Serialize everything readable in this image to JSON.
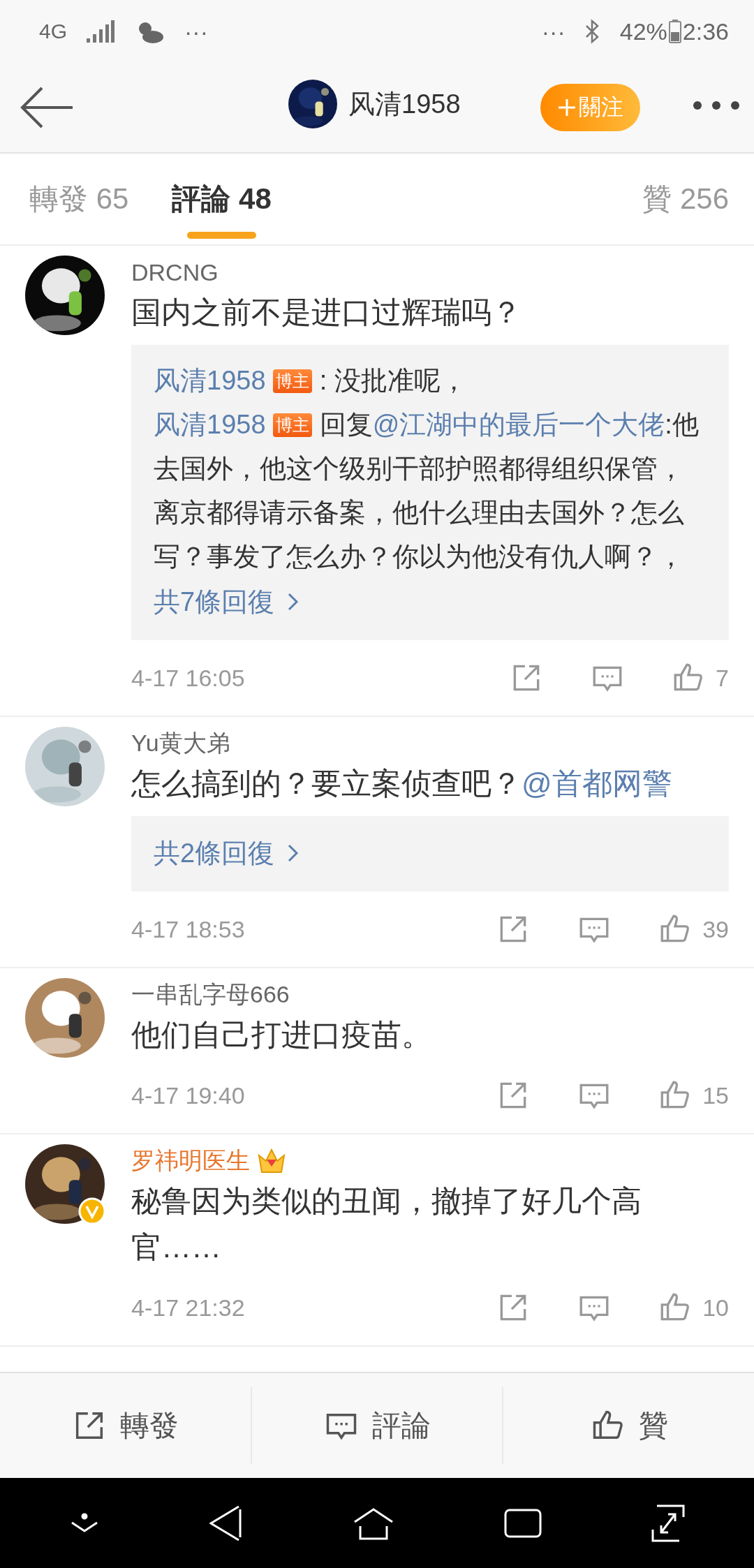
{
  "status_bar": {
    "network": "4G",
    "left_more": "···",
    "right_more": "···",
    "battery": "42%",
    "time": "2:36"
  },
  "header": {
    "title": "风清1958",
    "follow_button": "關注"
  },
  "tabs": [
    {
      "label": "轉發",
      "count": "65",
      "selected": false
    },
    {
      "label": "評論",
      "count": "48",
      "selected": true
    },
    {
      "label": "贊",
      "count": "256",
      "selected": false
    }
  ],
  "comments": [
    {
      "user": "DRCNG",
      "vip": false,
      "verified": false,
      "text": [
        {
          "kind": "text",
          "text": "国内之前不是进口过辉瑞吗？"
        }
      ],
      "replies": [
        {
          "author": "风清1958",
          "badge": "博主",
          "body": [
            {
              "kind": "text",
              "text": " : 没批准呢，"
            }
          ]
        },
        {
          "author": "风清1958",
          "badge": "博主",
          "body": [
            {
              "kind": "text",
              "text": " 回复"
            },
            {
              "kind": "mention",
              "text": "@江湖中的最后一个大佬"
            },
            {
              "kind": "text",
              "text": ":他去国外，他这个级别干部护照都得组织保管，离京都得请示备案，他什么理由去国外？怎么写？事发了怎么办？你以为他没有仇人啊？，"
            }
          ]
        }
      ],
      "more_replies": "共7條回復",
      "time": "4-17 16:05",
      "likes": "7"
    },
    {
      "user": "Yu黄大弟",
      "vip": false,
      "verified": false,
      "text": [
        {
          "kind": "text",
          "text": "怎么搞到的？要立案侦查吧？"
        },
        {
          "kind": "mention",
          "text": "@首都网警"
        }
      ],
      "more_replies": "共2條回復",
      "time": "4-17 18:53",
      "likes": "39"
    },
    {
      "user": "一串乱字母666",
      "vip": false,
      "verified": false,
      "text": [
        {
          "kind": "text",
          "text": "他们自己打进口疫苗。"
        }
      ],
      "time": "4-17 19:40",
      "likes": "15"
    },
    {
      "user": "罗祎明医生",
      "vip": true,
      "verified": true,
      "text": [
        {
          "kind": "text",
          "text": "秘鲁因为类似的丑闻，撤掉了好几个高官……"
        }
      ],
      "time": "4-17 21:32",
      "likes": "10"
    }
  ],
  "bottom_bar": [
    {
      "kind": "share",
      "label": "轉發"
    },
    {
      "kind": "comment",
      "label": "評論"
    },
    {
      "kind": "like",
      "label": "贊"
    }
  ]
}
